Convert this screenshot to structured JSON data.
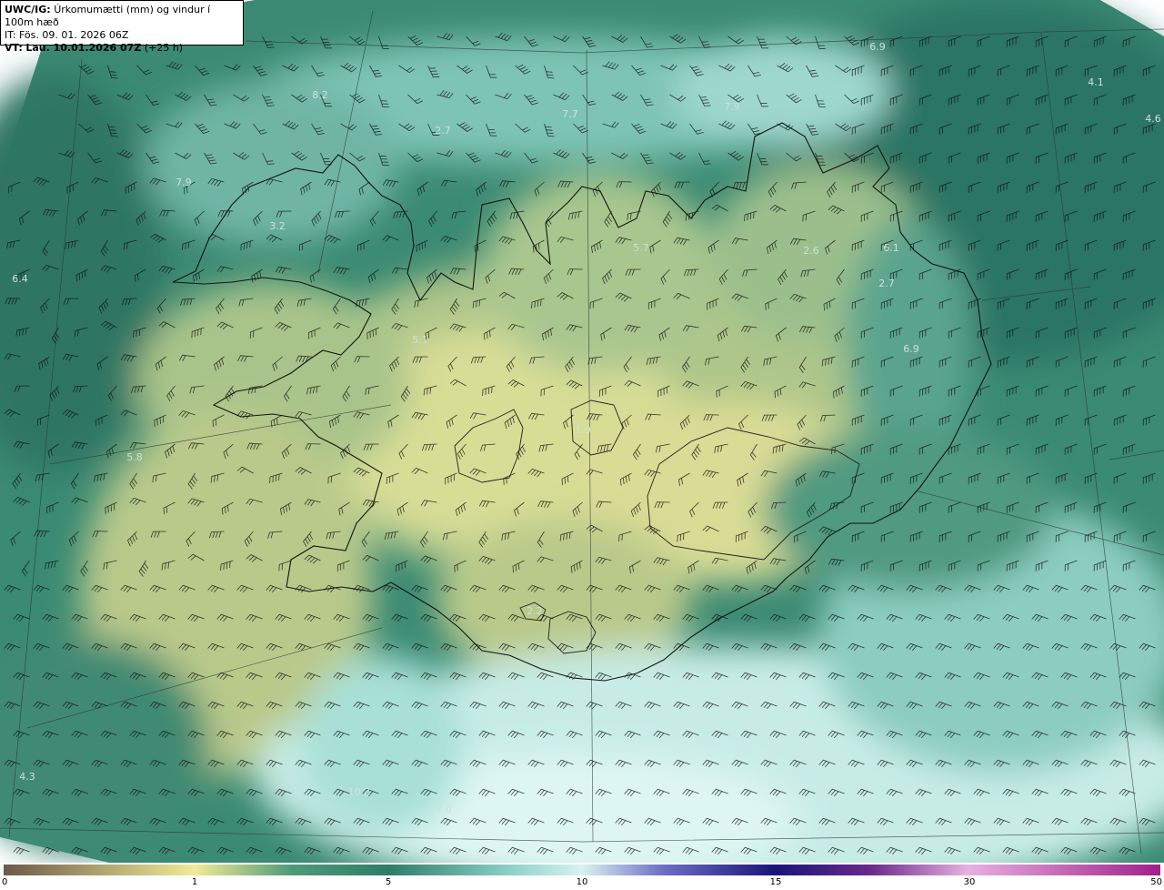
{
  "header": {
    "product_code": "UWC/IG:",
    "product_title": "Úrkomumætti (mm) og vindur í 100m hæð",
    "init_time": "IT: Fös. 09. 01. 2026 06Z",
    "valid_prefix": "VT:",
    "valid_time": "Lau. 10.01.2026 07Z",
    "lead_time": "(+25 h)"
  },
  "colorbar": {
    "ticks": [
      "0",
      "1",
      "5",
      "10",
      "15",
      "30",
      "50"
    ],
    "stops": [
      {
        "value": "0",
        "color": "#6b5a49"
      },
      {
        "value": "1",
        "color": "#f2ea98"
      },
      {
        "value": "3",
        "color": "#4e9a78"
      },
      {
        "value": "5",
        "color": "#2f7d68"
      },
      {
        "value": "8",
        "color": "#8fd2c8"
      },
      {
        "value": "10",
        "color": "#d8f3f0"
      },
      {
        "value": "12",
        "color": "#6e6ec4"
      },
      {
        "value": "15",
        "color": "#1a1478"
      },
      {
        "value": "22",
        "color": "#6a2a8a"
      },
      {
        "value": "30",
        "color": "#e8b0e0"
      },
      {
        "value": "50",
        "color": "#a0208a"
      }
    ]
  },
  "map_labels": [
    {
      "id": "l1",
      "text": "6.9"
    },
    {
      "id": "l2",
      "text": "4.1"
    },
    {
      "id": "l3",
      "text": "4.6"
    },
    {
      "id": "l4",
      "text": "8.2"
    },
    {
      "id": "l5",
      "text": "7.7"
    },
    {
      "id": "l6",
      "text": "7.9"
    },
    {
      "id": "l7",
      "text": "2.7"
    },
    {
      "id": "l8",
      "text": "7.9"
    },
    {
      "id": "l9",
      "text": "3.2"
    },
    {
      "id": "l10",
      "text": "5.7"
    },
    {
      "id": "l11",
      "text": "2.6"
    },
    {
      "id": "l12",
      "text": "6.1"
    },
    {
      "id": "l13",
      "text": "2.7"
    },
    {
      "id": "l14",
      "text": "6.4"
    },
    {
      "id": "l15",
      "text": "6.9"
    },
    {
      "id": "l16",
      "text": "5.1"
    },
    {
      "id": "l17",
      "text": "1.0"
    },
    {
      "id": "l18",
      "text": "5.8"
    },
    {
      "id": "l19",
      "text": "2.2"
    },
    {
      "id": "l20",
      "text": "4.3"
    },
    {
      "id": "l21",
      "text": "10.2"
    },
    {
      "id": "l22",
      "text": "7.0"
    }
  ],
  "colors": {
    "sea_dark": "#2a7462",
    "sea_mid": "#3e8c74",
    "land_yellow": "#c9d38c",
    "land_green": "#7bb084",
    "light_sea": "#a8dcd4",
    "barb": "#111111"
  }
}
